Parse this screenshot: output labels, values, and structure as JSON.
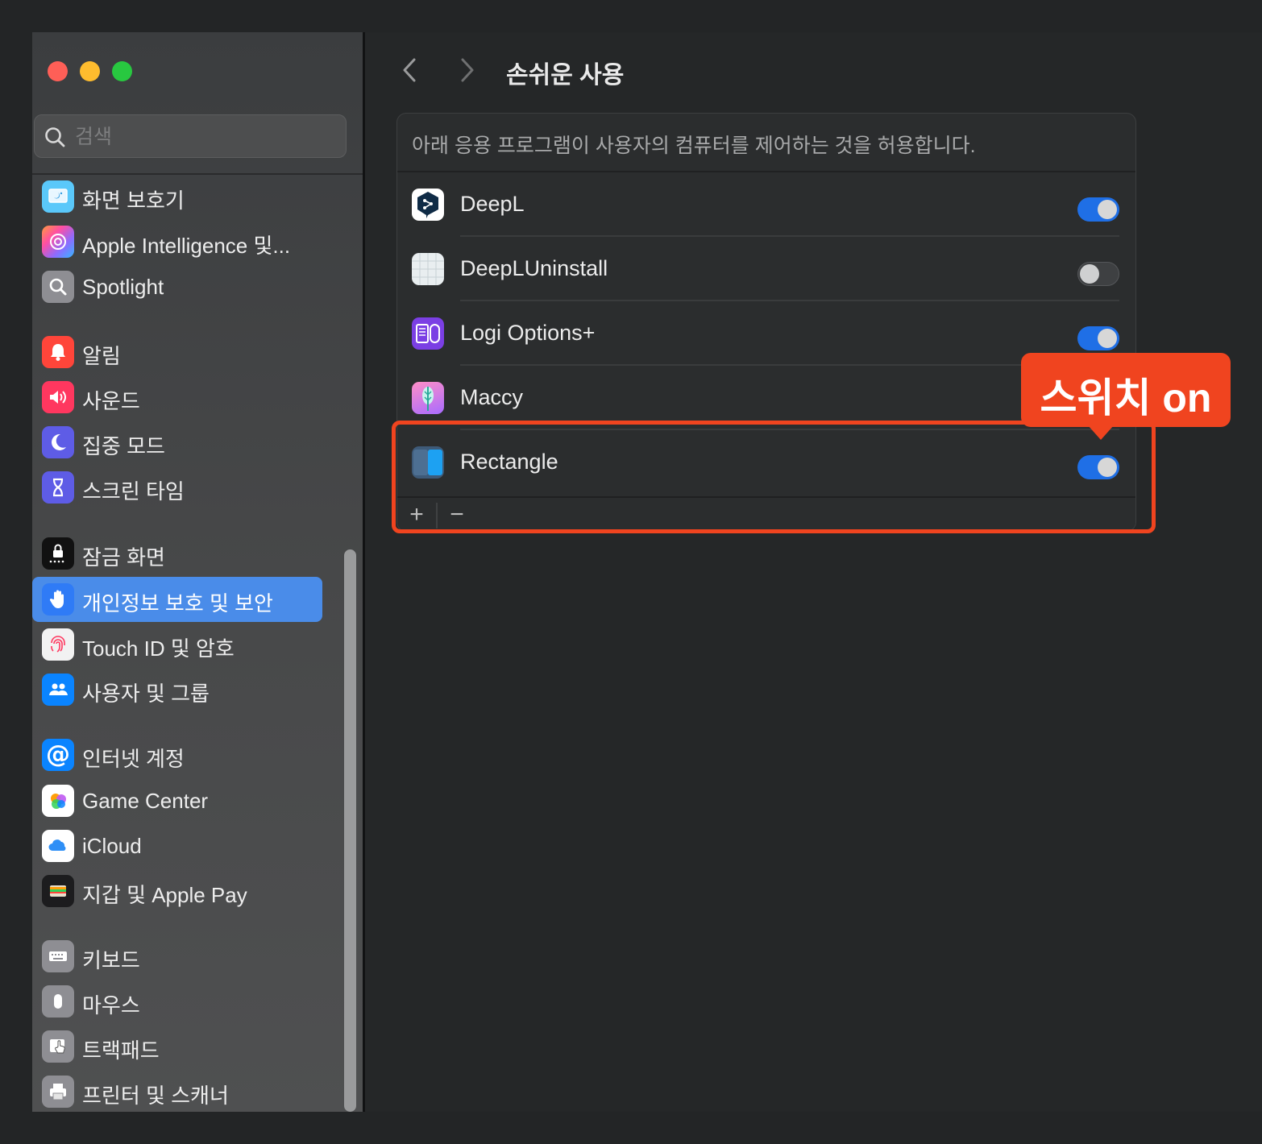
{
  "sidebar": {
    "search_placeholder": "검색",
    "items": [
      {
        "label": "화면 보호기"
      },
      {
        "label": "Apple Intelligence 및..."
      },
      {
        "label": "Spotlight"
      },
      {
        "label": "알림"
      },
      {
        "label": "사운드"
      },
      {
        "label": "집중 모드"
      },
      {
        "label": "스크린 타임"
      },
      {
        "label": "잠금 화면"
      },
      {
        "label": "개인정보 보호 및 보안",
        "selected": true
      },
      {
        "label": "Touch ID 및 암호"
      },
      {
        "label": "사용자 및 그룹"
      },
      {
        "label": "인터넷 계정"
      },
      {
        "label": "Game Center"
      },
      {
        "label": "iCloud"
      },
      {
        "label": "지갑 및 Apple Pay"
      },
      {
        "label": "키보드"
      },
      {
        "label": "마우스"
      },
      {
        "label": "트랙패드"
      },
      {
        "label": "프린터 및 스캐너"
      }
    ]
  },
  "header": {
    "title": "손쉬운 사용"
  },
  "panel": {
    "description": "아래 응용 프로그램이 사용자의 컴퓨터를 제어하는 것을 허용합니다.",
    "apps": [
      {
        "name": "DeepL",
        "enabled": true
      },
      {
        "name": "DeepLUninstall",
        "enabled": false
      },
      {
        "name": "Logi Options+",
        "enabled": true
      },
      {
        "name": "Maccy",
        "enabled": true
      },
      {
        "name": "Rectangle",
        "enabled": true
      }
    ],
    "add_label": "+",
    "remove_label": "−"
  },
  "annotation": {
    "callout_text": "스위치 on",
    "color": "#f0441f"
  },
  "colors": {
    "accent": "#4a8ce9",
    "toggle_on": "#1f6fe6"
  }
}
